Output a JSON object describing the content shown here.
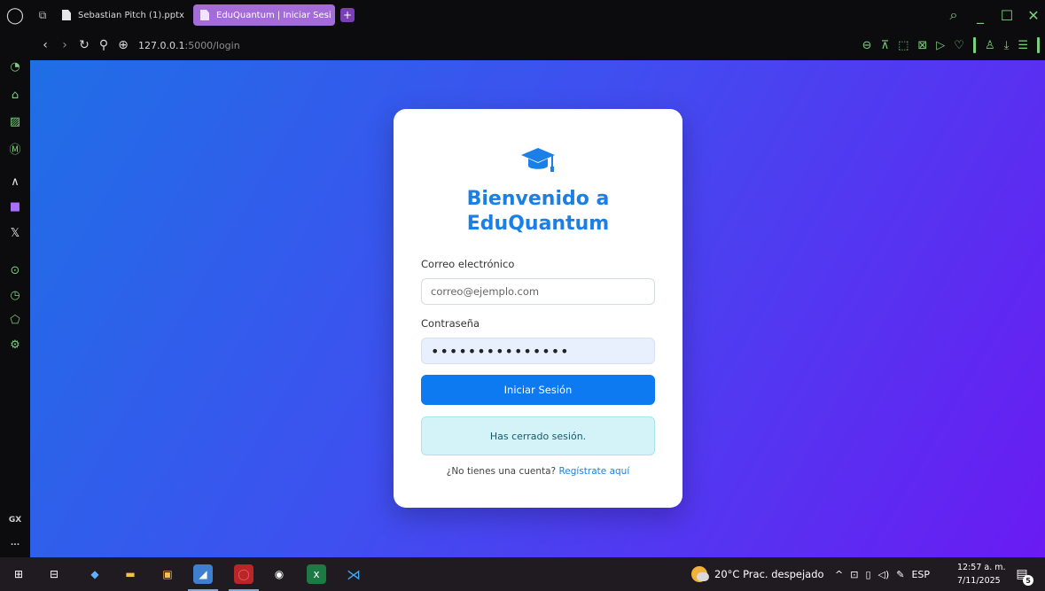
{
  "browser": {
    "tabs": [
      {
        "label": "Sebastian Pitch (1).pptx",
        "active": false
      },
      {
        "label": "EduQuantum | Iniciar Sesi",
        "active": true
      }
    ],
    "new_tab_symbol": "+",
    "url_host": "127.0.0.1",
    "url_path": ":5000/login",
    "window_controls": [
      "search-icon",
      "minimize-icon",
      "maximize-icon",
      "close-icon"
    ],
    "accent_color": "#7bd07b",
    "tab_active_color": "#a46cd8"
  },
  "sidebar": {
    "icons": [
      "speed-dial-icon",
      "flow-icon",
      "player-icon",
      "messenger-icon",
      "aria-icon",
      "twitch-icon",
      "x-icon",
      "music-player-icon",
      "history-icon",
      "extensions-icon",
      "settings-icon"
    ],
    "gx_label": "GX",
    "more_label": "..."
  },
  "login": {
    "title_line1": "Bienvenido a",
    "title_line2": "EduQuantum",
    "email_label": "Correo electrónico",
    "email_placeholder": "correo@ejemplo.com",
    "password_label": "Contraseña",
    "password_value": "•••••••••••••••",
    "submit_label": "Iniciar Sesión",
    "alert_message": "Has cerrado sesión.",
    "signup_prompt": "¿No tienes una cuenta?",
    "signup_link": "Regístrate aquí",
    "primary_color": "#0d7af2",
    "title_color": "#1a7fe6",
    "icon": "graduation-cap-icon"
  },
  "taskbar": {
    "apps": [
      "windows-start-icon",
      "task-view-icon",
      "copilot-icon",
      "file-explorer-icon",
      "store-icon",
      "photos-icon",
      "opera-gx-icon",
      "chat-icon",
      "excel-icon",
      "vscode-icon"
    ],
    "weather_temp": "20°C",
    "weather_desc": "Prac. despejado",
    "language": "ESP",
    "time": "12:57 a. m.",
    "date": "7/11/2025",
    "notification_count": "5"
  }
}
